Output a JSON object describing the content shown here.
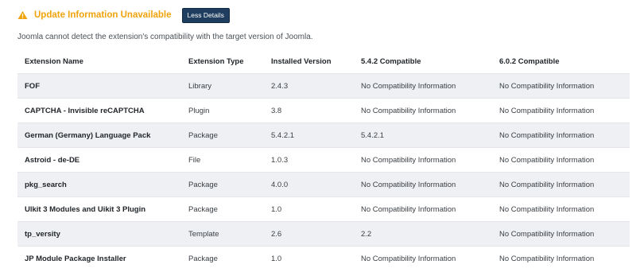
{
  "alert": {
    "icon": "warning-triangle-icon",
    "title": "Update Information Unavailable",
    "button_label": "Less Details",
    "color": "#f0a30a",
    "button_color": "#1f3d5e"
  },
  "description": "Joomla cannot detect the extension's compatibility with the target version of Joomla.",
  "table": {
    "headers": [
      "Extension Name",
      "Extension Type",
      "Installed Version",
      "5.4.2 Compatible",
      "6.0.2 Compatible"
    ],
    "rows": [
      {
        "name": "FOF",
        "type": "Library",
        "installed": "2.4.3",
        "compat_542": "No Compatibility Information",
        "compat_602": "No Compatibility Information"
      },
      {
        "name": "CAPTCHA - Invisible reCAPTCHA",
        "type": "Plugin",
        "installed": "3.8",
        "compat_542": "No Compatibility Information",
        "compat_602": "No Compatibility Information"
      },
      {
        "name": "German (Germany) Language Pack",
        "type": "Package",
        "installed": "5.4.2.1",
        "compat_542": "5.4.2.1",
        "compat_602": "No Compatibility Information"
      },
      {
        "name": "Astroid - de-DE",
        "type": "File",
        "installed": "1.0.3",
        "compat_542": "No Compatibility Information",
        "compat_602": "No Compatibility Information"
      },
      {
        "name": "pkg_search",
        "type": "Package",
        "installed": "4.0.0",
        "compat_542": "No Compatibility Information",
        "compat_602": "No Compatibility Information"
      },
      {
        "name": "Ulkit 3 Modules and Uikit 3 Plugin",
        "type": "Package",
        "installed": "1.0",
        "compat_542": "No Compatibility Information",
        "compat_602": "No Compatibility Information"
      },
      {
        "name": "tp_versity",
        "type": "Template",
        "installed": "2.6",
        "compat_542": "2.2",
        "compat_602": "No Compatibility Information"
      },
      {
        "name": "JP Module Package Installer",
        "type": "Package",
        "installed": "1.0",
        "compat_542": "No Compatibility Information",
        "compat_602": "No Compatibility Information"
      }
    ]
  }
}
